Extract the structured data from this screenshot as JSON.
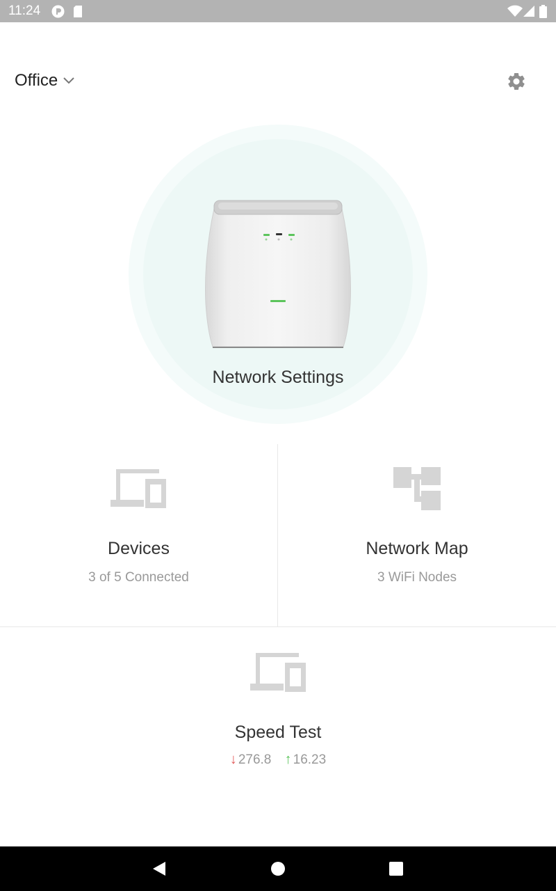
{
  "status_bar": {
    "time": "11:24",
    "icons": [
      "p-circle-icon",
      "sd-card-icon",
      "wifi-icon",
      "signal-icon",
      "battery-icon"
    ]
  },
  "header": {
    "location": "Office",
    "icons": [
      "chevron-down-icon",
      "gear-icon"
    ]
  },
  "hero": {
    "label": "Network Settings",
    "device_icon": "router-icon"
  },
  "tiles": {
    "devices": {
      "title": "Devices",
      "subtitle": "3 of 5 Connected",
      "icon": "devices-icon"
    },
    "network_map": {
      "title": "Network Map",
      "subtitle": "3 WiFi Nodes",
      "icon": "network-map-icon"
    },
    "speed_test": {
      "title": "Speed Test",
      "icon": "devices-icon",
      "download": "276.8",
      "upload": "16.23",
      "download_color": "#e25a5a",
      "upload_color": "#5cc45c"
    }
  },
  "nav_bar": {
    "icons": [
      "back-icon",
      "home-icon",
      "recents-icon"
    ]
  },
  "colors": {
    "status_bar": "#b3b3b3",
    "hero_ring": "#f4fbfa",
    "hero_inner": "#edf8f6",
    "icon_gray": "#d5d5d5",
    "led_green": "#5cc45c"
  }
}
